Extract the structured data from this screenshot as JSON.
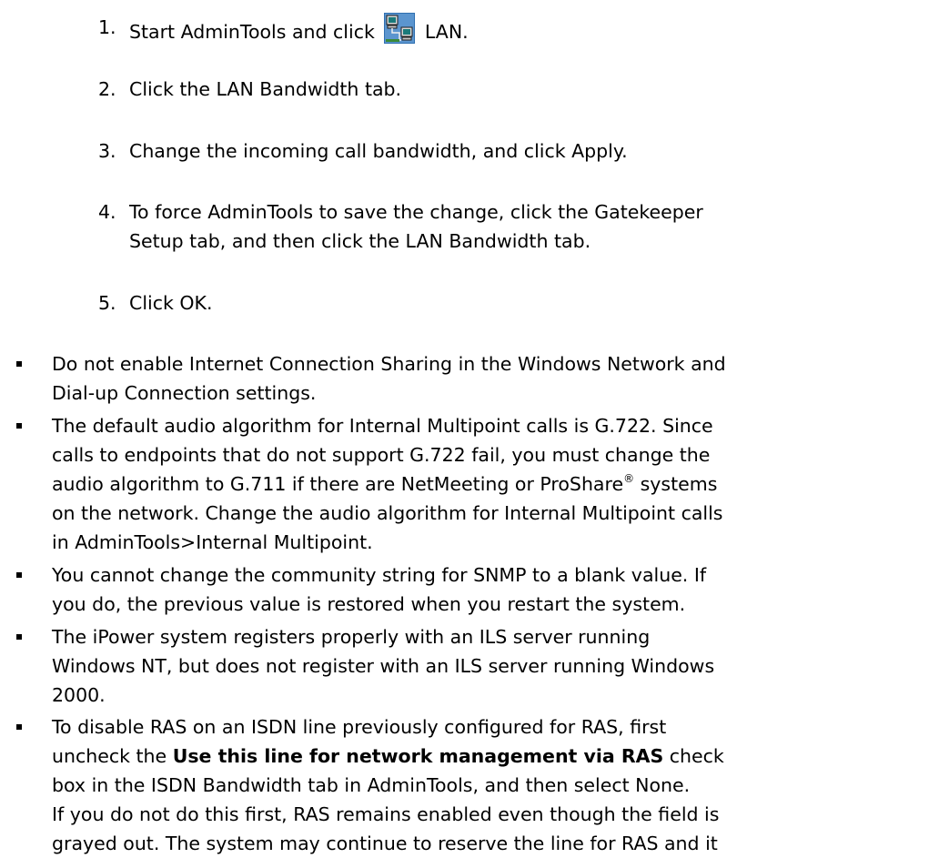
{
  "steps": [
    {
      "num": "1.",
      "before": "Start AdminTools and click",
      "icon": "lan-network-icon",
      "after": "LAN."
    },
    {
      "num": "2.",
      "text": "Click the LAN Bandwidth tab."
    },
    {
      "num": "3.",
      "text": "Change the incoming call bandwidth, and click Apply."
    },
    {
      "num": "4.",
      "line1": "To force AdminTools to save the change, click the Gatekeeper",
      "line2": "Setup tab, and then click the LAN Bandwidth tab."
    },
    {
      "num": "5.",
      "text": "Click OK."
    }
  ],
  "bullets": [
    {
      "lines": [
        "Do not enable Internet Connection Sharing in the Windows Network and",
        "Dial-up Connection settings."
      ]
    },
    {
      "line1": "The default audio algorithm for Internal Multipoint calls is G.722. Since",
      "line2": "calls to endpoints that do not support G.722 fail, you must change the",
      "line3_before": "audio algorithm to G.711 if there are NetMeeting or ProShare",
      "line3_sup": "®",
      "line3_after": " systems",
      "line4": "on the network. Change the audio algorithm for Internal Multipoint calls",
      "line5": "in AdminTools>Internal Multipoint."
    },
    {
      "lines": [
        "You cannot change the community string for SNMP to a blank value. If",
        "you do, the previous value is restored when you restart the system."
      ]
    },
    {
      "lines": [
        "The iPower system registers properly with an ILS server running",
        "Windows NT, but does not register with an ILS server running Windows",
        "2000."
      ]
    },
    {
      "line1": "To disable RAS on an ISDN line previously configured for RAS, first",
      "line2_before": "uncheck the ",
      "line2_bold": "Use this line for network management via RAS",
      "line2_after": " check",
      "line3": "box in the ISDN Bandwidth tab in AdminTools, and then select None.",
      "para2_line1": "If you do not do this first, RAS remains enabled even though the field is",
      "para2_line2": "grayed out. The system may continue to reserve the line for RAS and it"
    }
  ],
  "colors": {
    "text": "#000000",
    "background": "#ffffff"
  }
}
